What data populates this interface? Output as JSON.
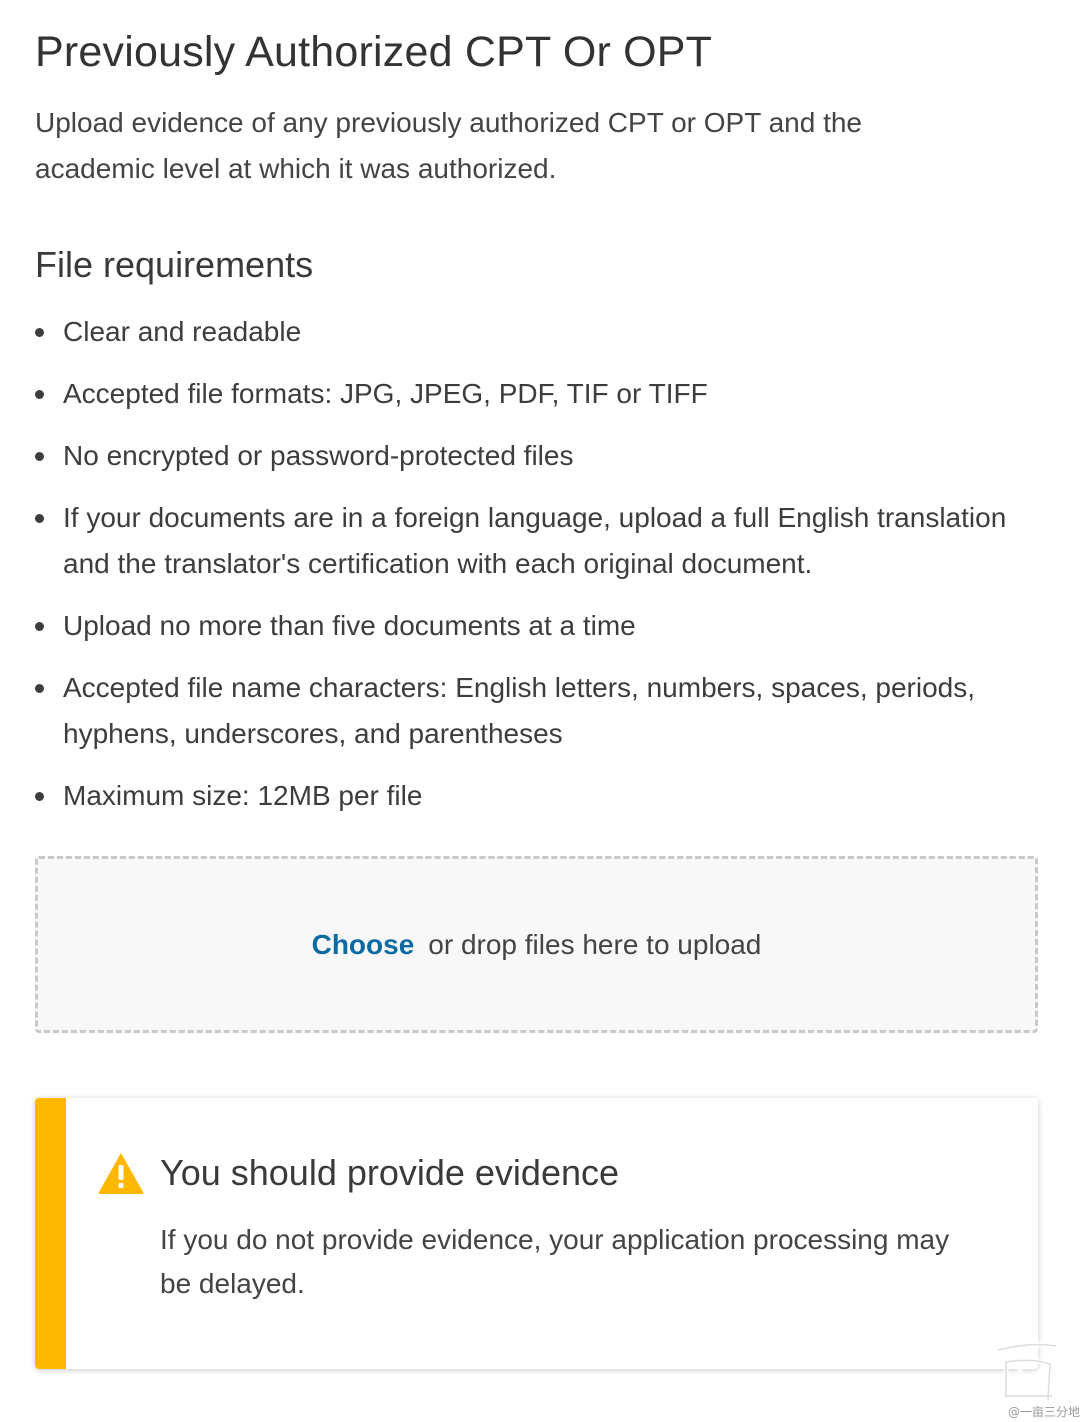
{
  "page": {
    "title": "Previously Authorized CPT Or OPT",
    "intro": "Upload evidence of any previously authorized CPT or OPT and the academic level at which it was authorized."
  },
  "requirements": {
    "heading": "File requirements",
    "items": [
      "Clear and readable",
      "Accepted file formats: JPG, JPEG, PDF, TIF or TIFF",
      "No encrypted or password-protected files",
      "If your documents are in a foreign language, upload a full English translation and the translator's certification with each original document.",
      "Upload no more than five documents at a time",
      "Accepted file name characters: English letters, numbers, spaces, periods, hyphens, underscores, and parentheses",
      "Maximum size: 12MB per file"
    ]
  },
  "upload": {
    "choose_label": "Choose",
    "drop_text": "or drop files here to upload"
  },
  "alert": {
    "icon": "warning-icon",
    "title": "You should provide evidence",
    "body": "If you do not provide evidence, your application processing may be delayed.",
    "accent_color": "#ffb800"
  },
  "watermark": {
    "text": "@一亩三分地"
  },
  "colors": {
    "link": "#0b6aa2",
    "text": "#3d3d3d",
    "warning": "#ffb800"
  }
}
